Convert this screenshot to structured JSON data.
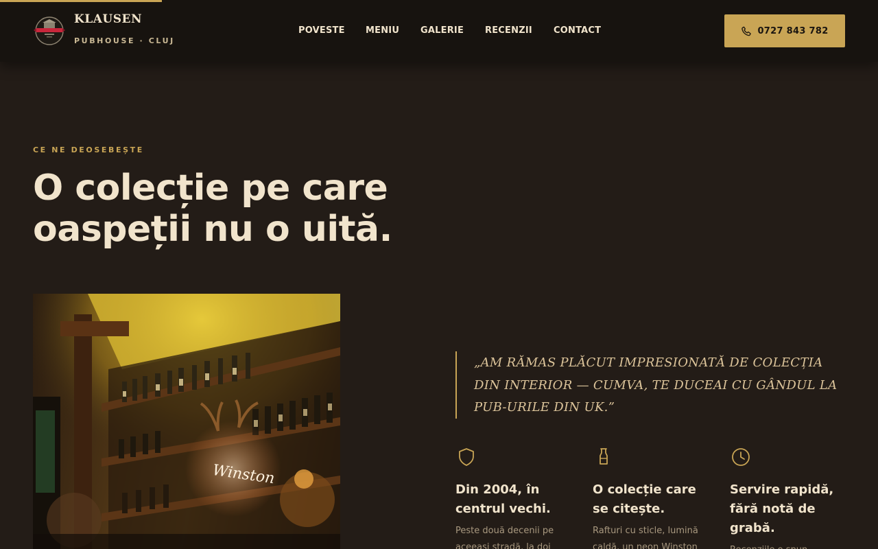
{
  "header": {
    "brand_name": "KLAUSEN",
    "brand_sub": "PUBHOUSE · CLUJ",
    "nav": [
      "POVESTE",
      "MENIU",
      "GALERIE",
      "RECENZII",
      "CONTACT"
    ],
    "phone_label": "0727 843 782",
    "accent_color": "#c9a555",
    "logo_icon": "pub-crest-icon",
    "phone_icon": "phone-icon"
  },
  "hero": {
    "eyebrow": "CE NE DEOSEBEȘTE",
    "headline_line1": "O colecție pe care",
    "headline_line2": "oaspeții nu o uită."
  },
  "photo": {
    "icon": "bar-shelves-photo"
  },
  "quote": {
    "text": "„Am rămas plăcut impresionată de colecția din interior — cumva, te duceai cu gândul la pub-urile din UK.”"
  },
  "features": [
    {
      "icon": "shield-icon",
      "title": "Din 2004, în centrul vechi.",
      "text": "Peste două decenii pe aceeași stradă, la doi"
    },
    {
      "icon": "flask-icon",
      "title": "O colecție care se citește.",
      "text": "Rafturi cu sticle, lumină caldă, un neon Winston"
    },
    {
      "icon": "clock-icon",
      "title": "Servire rapidă, fără notă de grabă.",
      "text": "Recenziile o spun"
    }
  ]
}
